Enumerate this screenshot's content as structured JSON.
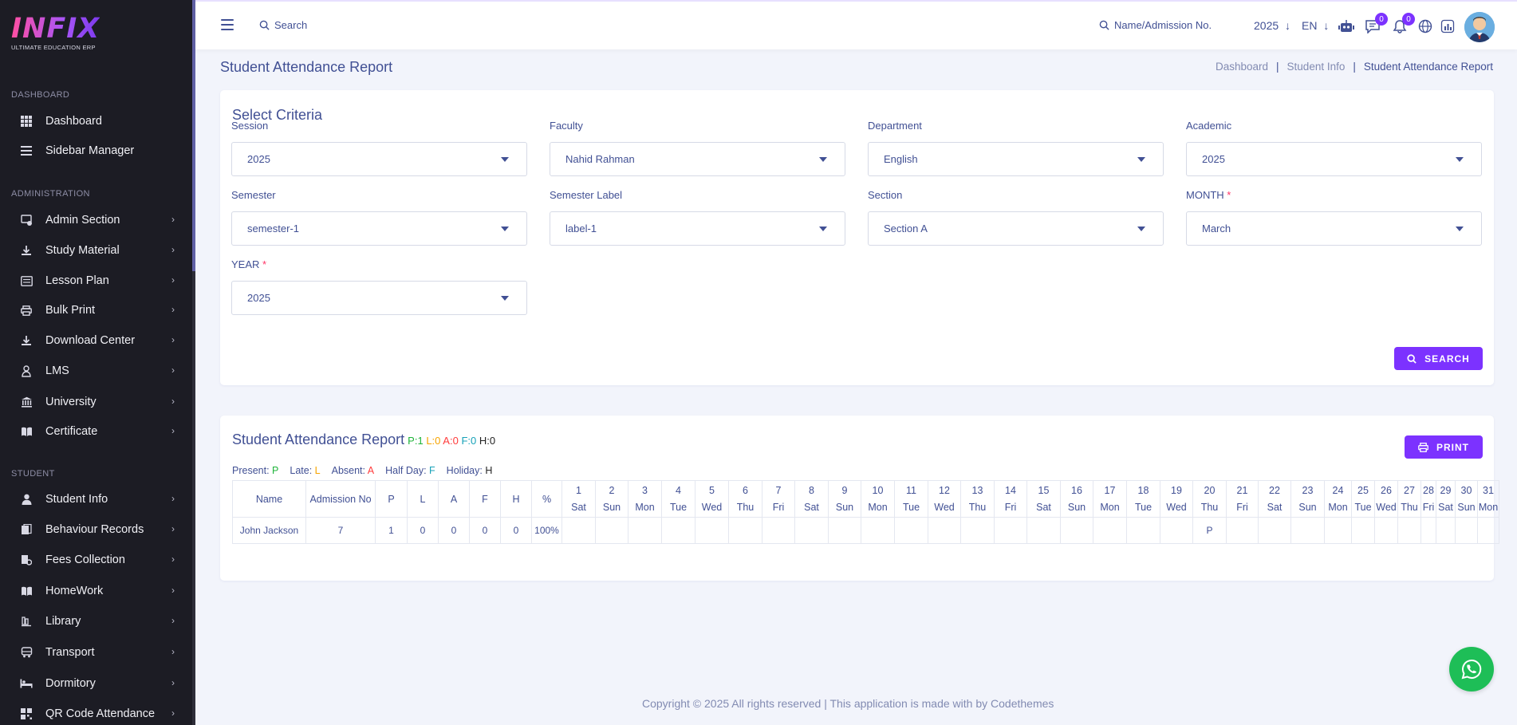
{
  "brand": {
    "logo_text": "INFIX",
    "tagline": "ULTIMATE EDUCATION ERP"
  },
  "sidebar": {
    "sections": [
      {
        "label": "DASHBOARD",
        "items": [
          {
            "label": "Dashboard",
            "icon": "grid-icon",
            "expandable": false
          },
          {
            "label": "Sidebar Manager",
            "icon": "menu-icon",
            "expandable": false
          }
        ]
      },
      {
        "label": "ADMINISTRATION",
        "items": [
          {
            "label": "Admin Section",
            "icon": "admin-icon",
            "expandable": true
          },
          {
            "label": "Study Material",
            "icon": "download-icon",
            "expandable": true
          },
          {
            "label": "Lesson Plan",
            "icon": "lesson-icon",
            "expandable": true
          },
          {
            "label": "Bulk Print",
            "icon": "print-icon",
            "expandable": true
          },
          {
            "label": "Download Center",
            "icon": "download-icon",
            "expandable": true
          },
          {
            "label": "LMS",
            "icon": "lms-icon",
            "expandable": true
          },
          {
            "label": "University",
            "icon": "university-icon",
            "expandable": true
          },
          {
            "label": "Certificate",
            "icon": "book-icon",
            "expandable": true
          }
        ]
      },
      {
        "label": "STUDENT",
        "items": [
          {
            "label": "Student Info",
            "icon": "user-icon",
            "expandable": true
          },
          {
            "label": "Behaviour Records",
            "icon": "records-icon",
            "expandable": true
          },
          {
            "label": "Fees Collection",
            "icon": "fees-icon",
            "expandable": true
          },
          {
            "label": "HomeWork",
            "icon": "book-icon",
            "expandable": true
          },
          {
            "label": "Library",
            "icon": "library-icon",
            "expandable": true
          },
          {
            "label": "Transport",
            "icon": "transport-icon",
            "expandable": true
          },
          {
            "label": "Dormitory",
            "icon": "bed-icon",
            "expandable": true
          },
          {
            "label": "QR Code Attendance",
            "icon": "qr-icon",
            "expandable": true
          }
        ]
      }
    ]
  },
  "header": {
    "search_placeholder": "Search",
    "global_search_placeholder": "Name/Admission No.",
    "year": "2025",
    "language": "EN",
    "messages_count": "0",
    "notifications_count": "0"
  },
  "page": {
    "title": "Student Attendance Report",
    "breadcrumb": [
      "Dashboard",
      "Student Info",
      "Student Attendance Report"
    ]
  },
  "criteria": {
    "title": "Select Criteria",
    "fields": [
      {
        "label": "Session",
        "value": "2025",
        "required": false
      },
      {
        "label": "Faculty",
        "value": "Nahid Rahman",
        "required": false
      },
      {
        "label": "Department",
        "value": "English",
        "required": false
      },
      {
        "label": "Academic",
        "value": "2025",
        "required": false
      },
      {
        "label": "Semester",
        "value": "semester-1",
        "required": false
      },
      {
        "label": "Semester Label",
        "value": "label-1",
        "required": false
      },
      {
        "label": "Section",
        "value": "Section A",
        "required": false
      },
      {
        "label": "MONTH",
        "value": "March",
        "required": true
      },
      {
        "label": "YEAR",
        "value": "2025",
        "required": true
      }
    ],
    "search_label": "SEARCH"
  },
  "report": {
    "title": "Student Attendance Report",
    "counts": {
      "P": "P:1",
      "L": "L:0",
      "A": "A:0",
      "F": "F:0",
      "H": "H:0"
    },
    "print_label": "PRINT",
    "legend": [
      {
        "label": "Present:",
        "code": "P",
        "color": "#1fb43a"
      },
      {
        "label": "Late:",
        "code": "L",
        "color": "#f7a400"
      },
      {
        "label": "Absent:",
        "code": "A",
        "color": "#ff3b3b"
      },
      {
        "label": "Half Day:",
        "code": "F",
        "color": "#17a2b8"
      },
      {
        "label": "Holiday:",
        "code": "H",
        "color": "#222222"
      }
    ],
    "columns": [
      "Name",
      "Admission No",
      "P",
      "L",
      "A",
      "F",
      "H",
      "%"
    ],
    "days": [
      {
        "n": "1",
        "d": "Sat"
      },
      {
        "n": "2",
        "d": "Sun"
      },
      {
        "n": "3",
        "d": "Mon"
      },
      {
        "n": "4",
        "d": "Tue"
      },
      {
        "n": "5",
        "d": "Wed"
      },
      {
        "n": "6",
        "d": "Thu"
      },
      {
        "n": "7",
        "d": "Fri"
      },
      {
        "n": "8",
        "d": "Sat"
      },
      {
        "n": "9",
        "d": "Sun"
      },
      {
        "n": "10",
        "d": "Mon"
      },
      {
        "n": "11",
        "d": "Tue"
      },
      {
        "n": "12",
        "d": "Wed"
      },
      {
        "n": "13",
        "d": "Thu"
      },
      {
        "n": "14",
        "d": "Fri"
      },
      {
        "n": "15",
        "d": "Sat"
      },
      {
        "n": "16",
        "d": "Sun"
      },
      {
        "n": "17",
        "d": "Mon"
      },
      {
        "n": "18",
        "d": "Tue"
      },
      {
        "n": "19",
        "d": "Wed"
      },
      {
        "n": "20",
        "d": "Thu"
      },
      {
        "n": "21",
        "d": "Fri"
      },
      {
        "n": "22",
        "d": "Sat"
      },
      {
        "n": "23",
        "d": "Sun"
      },
      {
        "n": "24",
        "d": "Mon"
      },
      {
        "n": "25",
        "d": "Tue"
      },
      {
        "n": "26",
        "d": "Wed"
      },
      {
        "n": "27",
        "d": "Thu"
      },
      {
        "n": "28",
        "d": "Fri"
      },
      {
        "n": "29",
        "d": "Sat"
      },
      {
        "n": "30",
        "d": "Sun"
      },
      {
        "n": "31",
        "d": "Mon"
      }
    ],
    "rows": [
      {
        "name": "John Jackson",
        "admission_no": "7",
        "P": "1",
        "L": "0",
        "A": "0",
        "F": "0",
        "H": "0",
        "percent": "100%",
        "attendance": [
          "",
          "",
          "",
          "",
          "",
          "",
          "",
          "",
          "",
          "",
          "",
          "",
          "",
          "",
          "",
          "",
          "",
          "",
          "",
          "P",
          "",
          "",
          "",
          "",
          "",
          "",
          "",
          "",
          "",
          "",
          ""
        ]
      }
    ]
  },
  "footer": {
    "text": "Copyright © 2025 All rights reserved | This application is made with by Codethemes"
  },
  "colors": {
    "accent": "#7c32ff",
    "text": "#415094",
    "sidebar": "#1c1c24",
    "whatsapp": "#1ebe57"
  }
}
